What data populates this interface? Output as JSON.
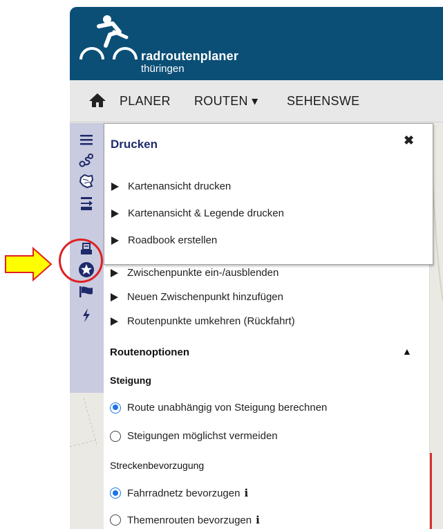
{
  "header": {
    "brand_line1": "radroutenplaner",
    "brand_line2": "thüringen"
  },
  "topnav": {
    "home_icon": "home-icon",
    "items": [
      {
        "label": "PLANER"
      },
      {
        "label": "ROUTEN ▾"
      },
      {
        "label": "SEHENSWE"
      }
    ]
  },
  "rail": {
    "icons": [
      "hamburger-menu-icon",
      "route-icon",
      "region-map-icon",
      "road-sign-icon",
      "printer-icon",
      "star-badge-icon",
      "flag-icon",
      "lightning-icon"
    ]
  },
  "popup": {
    "title": "Drucken",
    "close": "✖",
    "items": [
      {
        "label": "Kartenansicht drucken"
      },
      {
        "label": "Kartenansicht & Legende drucken"
      },
      {
        "label": "Roadbook erstellen"
      }
    ]
  },
  "panel": {
    "items": [
      {
        "label": "Zwischenpunkte ein-/ausblenden"
      },
      {
        "label": "Neuen Zwischenpunkt hinzufügen"
      },
      {
        "label": "Routenpunkte umkehren (Rückfahrt)"
      }
    ],
    "routenoptionen": {
      "title": "Routenoptionen",
      "toggle": "▲"
    },
    "steigung": {
      "title": "Steigung",
      "options": [
        {
          "label": "Route unabhängig von Steigung berechnen",
          "selected": true
        },
        {
          "label": "Steigungen möglichst vermeiden",
          "selected": false
        }
      ]
    },
    "strecke": {
      "title": "Streckenbevorzugung",
      "options": [
        {
          "label": "Fahrradnetz bevorzugen",
          "selected": true,
          "info": "i"
        },
        {
          "label": "Themenrouten bevorzugen",
          "selected": false,
          "info": "i"
        }
      ]
    }
  },
  "colors": {
    "header_bg": "#0b4f76",
    "rail_bg": "#c9cbe0",
    "accent_blue": "#1a73e8",
    "annotation_red": "#e02020",
    "annotation_yellow": "#ffff00"
  }
}
